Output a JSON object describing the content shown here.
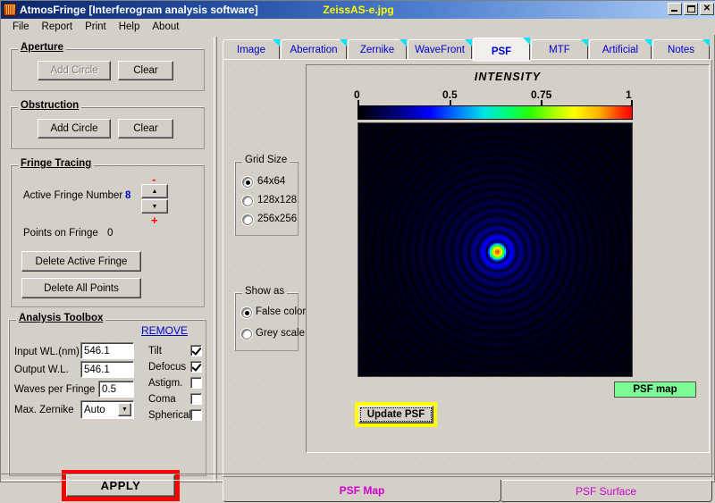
{
  "window": {
    "app_title": "AtmosFringe  [Interferogram analysis software]",
    "doc_title": "ZeissAS-e.jpg",
    "icon": "app-icon",
    "minimize": "_",
    "maximize": "□",
    "close": "✕"
  },
  "menu": {
    "items": [
      "File",
      "Report",
      "Print",
      "Help",
      "About"
    ]
  },
  "aperture": {
    "title": "Aperture",
    "add_circle": "Add Circle",
    "clear": "Clear"
  },
  "obstruction": {
    "title": "Obstruction",
    "add_circle": "Add Circle",
    "clear": "Clear"
  },
  "fringe_tracing": {
    "title": "Fringe Tracing",
    "active_fringe_label": "Active Fringe Number",
    "active_fringe_value": "8",
    "minus_sign": "-",
    "plus_sign": "+",
    "spin_up": "▲",
    "spin_down": "▼",
    "points_on_fringe_label": "Points on  Fringe",
    "points_on_fringe_value": "0",
    "delete_active_fringe": "Delete Active Fringe",
    "delete_all_points": "Delete  All  Points"
  },
  "analysis_toolbox": {
    "title": "Analysis  Toolbox",
    "remove_link": "REMOVE",
    "fields": [
      {
        "label": "Input WL.(nm)",
        "value": "546.1"
      },
      {
        "label": "Output W.L.",
        "value": "546.1"
      },
      {
        "label": "Waves per Fringe",
        "value": "0.5"
      }
    ],
    "max_zernike_label": "Max. Zernike",
    "max_zernike_value": "Auto",
    "combo_arrow": "▼",
    "aberrations": [
      {
        "label": "Tilt",
        "checked": true
      },
      {
        "label": "Defocus",
        "checked": true
      },
      {
        "label": "Astigm.",
        "checked": false
      },
      {
        "label": "Coma",
        "checked": false
      },
      {
        "label": "Spherical",
        "checked": false
      }
    ],
    "apply": "APPLY"
  },
  "tabs": {
    "items": [
      "Image",
      "Aberration",
      "Zernike",
      "WaveFront",
      "PSF",
      "MTF",
      "Artificial",
      "Notes"
    ],
    "active": "PSF"
  },
  "grid_size": {
    "title": "Grid Size",
    "options": [
      "64x64",
      "128x128",
      "256x256"
    ],
    "selected": "64x64"
  },
  "show_as": {
    "title": "Show as",
    "options": [
      "False color",
      "Grey scale"
    ],
    "selected": "False color"
  },
  "psf_panel": {
    "intensity_title": "INTENSITY",
    "colorbar_ticks": [
      {
        "label": "0",
        "pos": 0
      },
      {
        "label": "0.5",
        "pos": 0.335
      },
      {
        "label": "0.75",
        "pos": 0.665
      },
      {
        "label": "1",
        "pos": 1
      }
    ],
    "psf_map_badge": "PSF map",
    "update_button": "Update PSF",
    "colors": {
      "badge_bg": "#7cfc96",
      "update_frame": "#ffff00",
      "apply_frame": "#ff0000",
      "tab_text": "#0000cd",
      "bottom_tab_text": "#cc00cc",
      "doc_title": "#ffff00"
    }
  },
  "bottom_tabs": {
    "items": [
      "PSF  Map",
      "PSF Surface"
    ],
    "active": "PSF  Map"
  }
}
